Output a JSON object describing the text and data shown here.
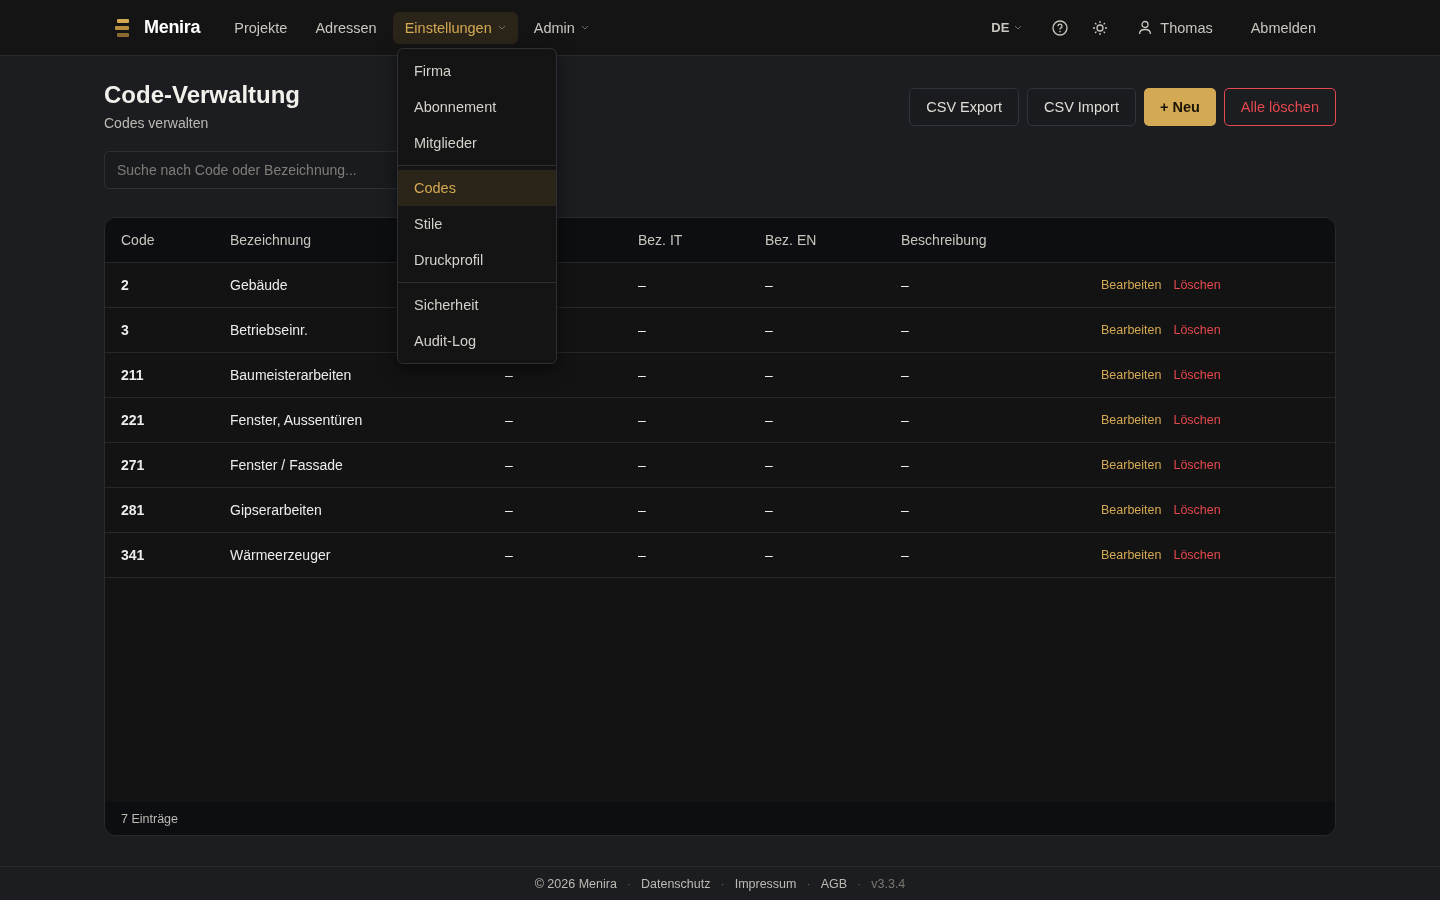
{
  "brand": {
    "name": "Menira"
  },
  "nav": [
    {
      "label": "Projekte",
      "selected": false,
      "dropdown": false
    },
    {
      "label": "Adressen",
      "selected": false,
      "dropdown": false
    },
    {
      "label": "Einstellungen",
      "selected": true,
      "dropdown": true
    },
    {
      "label": "Admin",
      "selected": false,
      "dropdown": true
    }
  ],
  "header_right": {
    "language": "DE",
    "user": "Thomas",
    "logout": "Abmelden"
  },
  "menu": {
    "groups": [
      [
        {
          "label": "Firma",
          "selected": false
        },
        {
          "label": "Abonnement",
          "selected": false
        },
        {
          "label": "Mitglieder",
          "selected": false
        }
      ],
      [
        {
          "label": "Codes",
          "selected": true
        },
        {
          "label": "Stile",
          "selected": false
        },
        {
          "label": "Druckprofil",
          "selected": false
        }
      ],
      [
        {
          "label": "Sicherheit",
          "selected": false
        },
        {
          "label": "Audit-Log",
          "selected": false
        }
      ]
    ]
  },
  "page": {
    "title": "Code-Verwaltung",
    "subtitle": "Codes verwalten"
  },
  "actions": [
    {
      "label": "CSV Export",
      "kind": "outline"
    },
    {
      "label": "CSV Import",
      "kind": "outline"
    },
    {
      "label": "+ Neu",
      "kind": "primary"
    },
    {
      "label": "Alle löschen",
      "kind": "danger"
    }
  ],
  "search": {
    "placeholder": "Suche nach Code oder Bezeichnung..."
  },
  "table": {
    "columns": [
      {
        "label": "Code"
      },
      {
        "label": "Bezeichnung"
      },
      {},
      {
        "label": "Bez. IT"
      },
      {
        "label": "Bez. EN"
      },
      {
        "label": "Beschreibung"
      }
    ],
    "rows": [
      {
        "code": "2",
        "name": "Gebäude",
        "bez_it": "–",
        "bez_en": "–",
        "description": "–",
        "edit": "Bearbeiten",
        "delete": "Löschen"
      },
      {
        "code": "3",
        "name": "Betriebseinr.",
        "bez_it": "–",
        "bez_en": "–",
        "description": "–",
        "edit": "Bearbeiten",
        "delete": "Löschen"
      },
      {
        "code": "211",
        "name": "Baumeisterarbeiten",
        "column_3": "–",
        "bez_it": "–",
        "bez_en": "–",
        "description": "–",
        "edit": "Bearbeiten",
        "delete": "Löschen"
      },
      {
        "code": "221",
        "name": "Fenster, Aussentüren",
        "column_3": "–",
        "bez_it": "–",
        "bez_en": "–",
        "description": "–",
        "edit": "Bearbeiten",
        "delete": "Löschen"
      },
      {
        "code": "271",
        "name": "Fenster / Fassade",
        "column_3": "–",
        "bez_it": "–",
        "bez_en": "–",
        "description": "–",
        "edit": "Bearbeiten",
        "delete": "Löschen"
      },
      {
        "code": "281",
        "name": "Gipserarbeiten",
        "column_3": "–",
        "bez_it": "–",
        "bez_en": "–",
        "description": "–",
        "edit": "Bearbeiten",
        "delete": "Löschen"
      },
      {
        "code": "341",
        "name": "Wärmeerzeuger",
        "column_3": "–",
        "bez_it": "–",
        "bez_en": "–",
        "description": "–",
        "edit": "Bearbeiten",
        "delete": "Löschen"
      }
    ],
    "footer": "7 Einträge"
  },
  "footer": {
    "separator": "·",
    "items": [
      {
        "label": "© 2026 Menira",
        "kind": "text"
      },
      {
        "label": "Datenschutz",
        "kind": "link"
      },
      {
        "label": "Impressum",
        "kind": "link"
      },
      {
        "label": "AGB",
        "kind": "link"
      },
      {
        "label": "v3.3.4",
        "kind": "version"
      }
    ]
  }
}
